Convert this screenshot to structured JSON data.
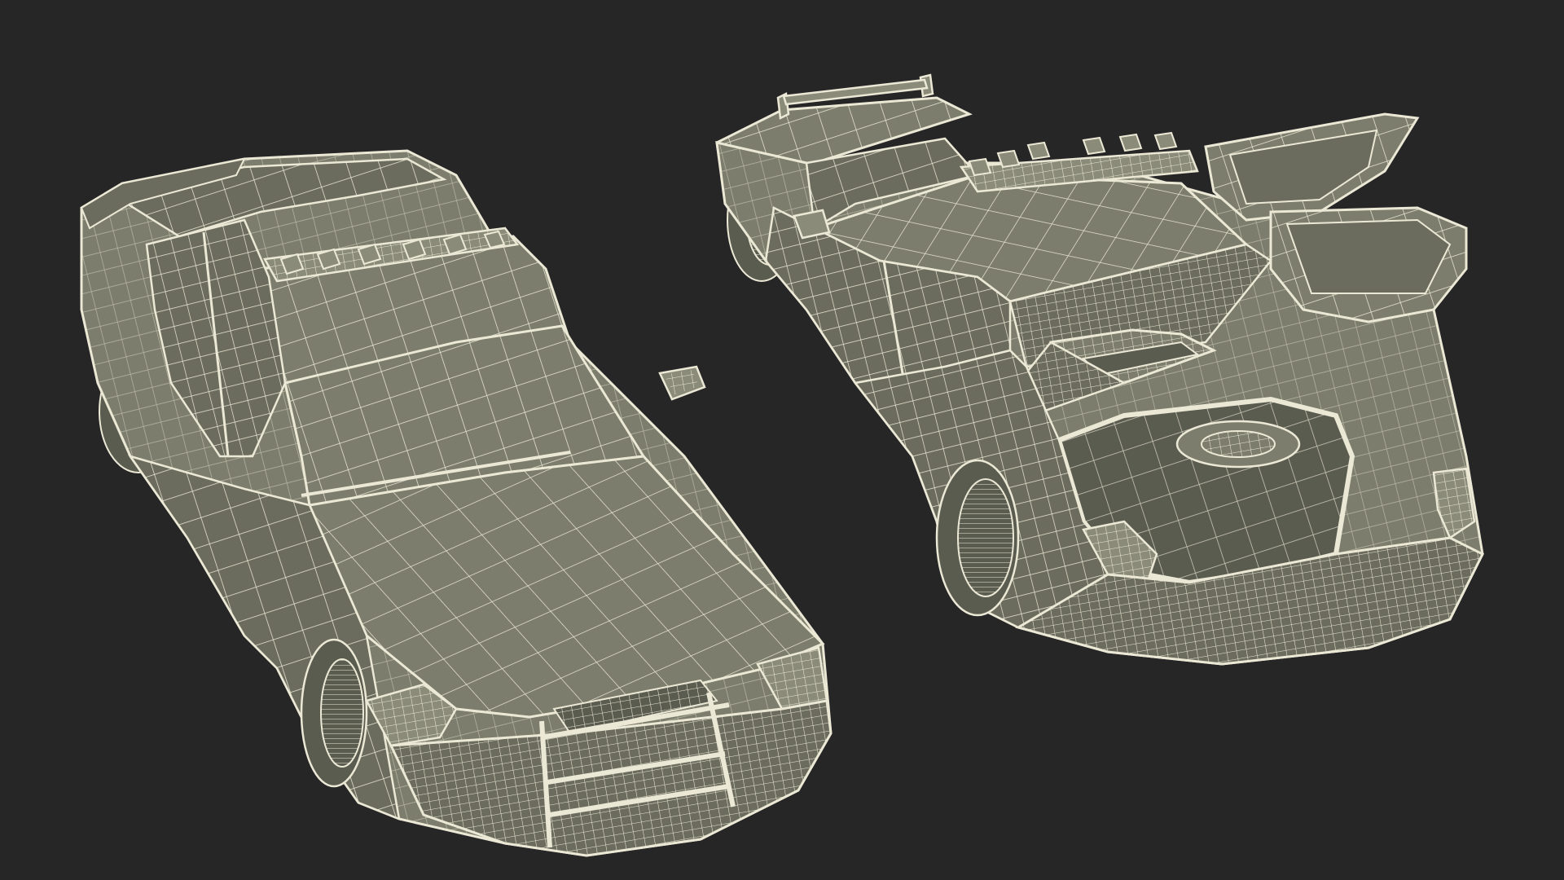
{
  "scene": {
    "background": "#262626",
    "mesh_fill": "#7c7d6c",
    "mesh_fill_dark": "#6b6c5d",
    "mesh_fill_deep": "#5b5c50",
    "wire_color": "#ece8d6",
    "subjects": [
      {
        "name": "police-car-front-view"
      },
      {
        "name": "police-car-rear-view-open"
      }
    ]
  }
}
